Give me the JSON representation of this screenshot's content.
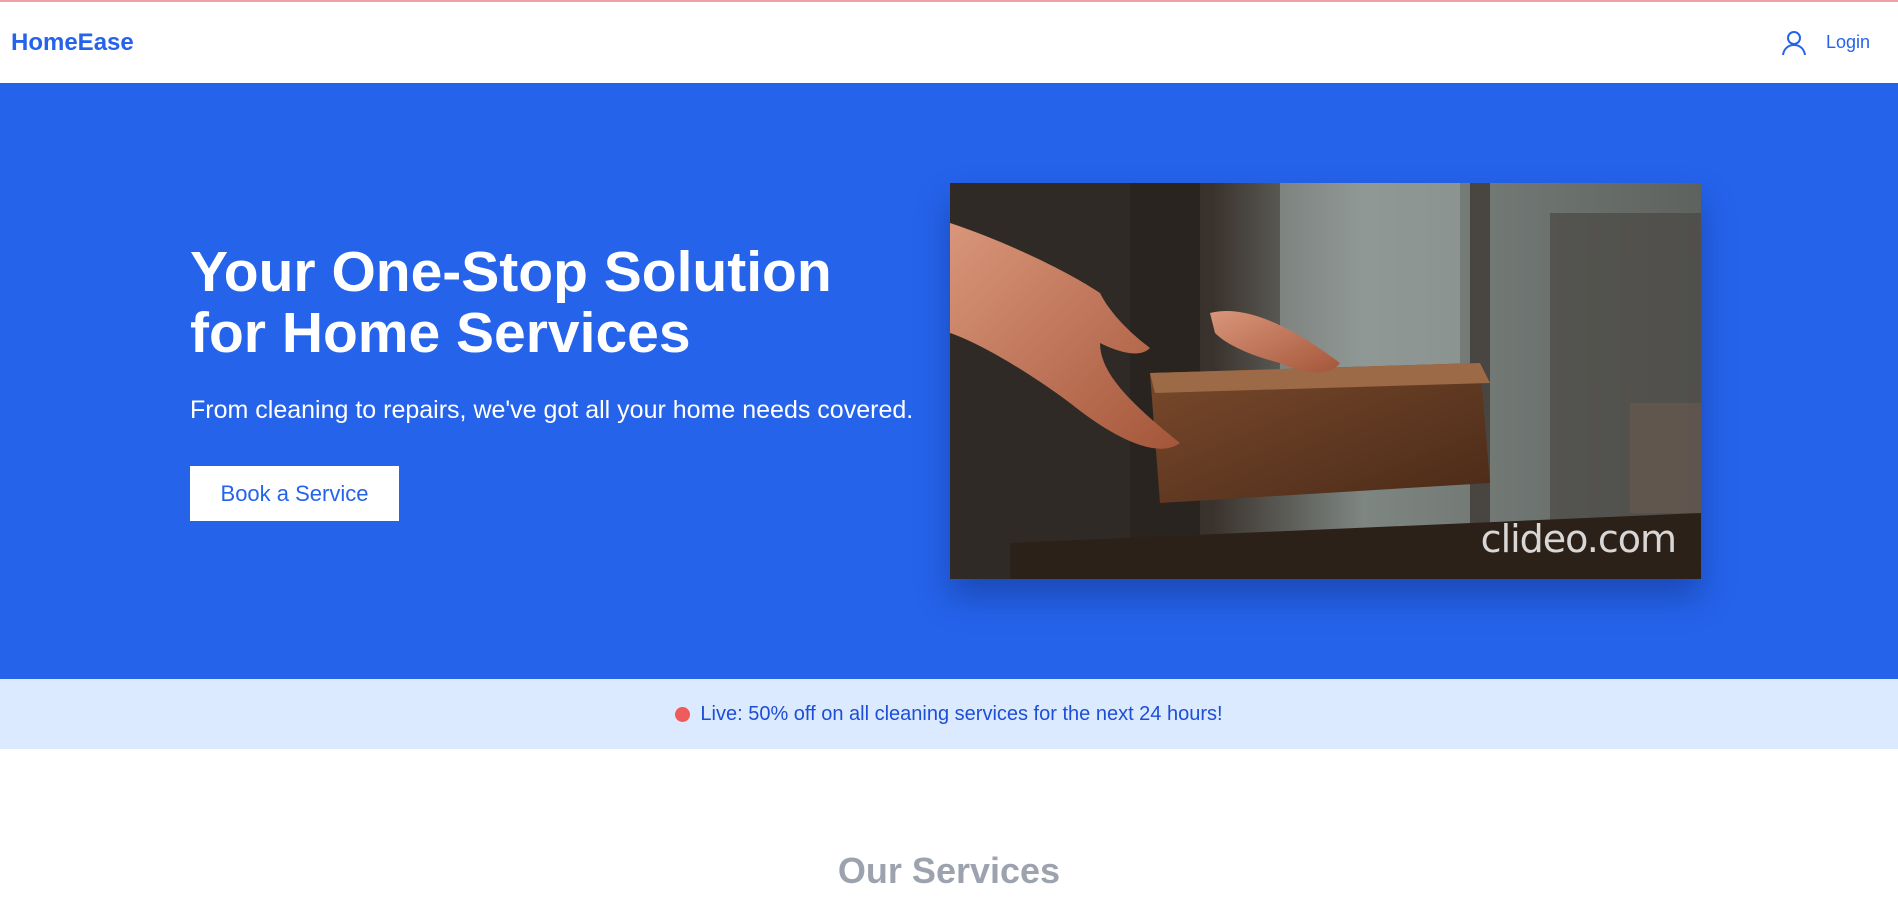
{
  "nav": {
    "brand": "HomeEase",
    "login_label": "Login",
    "user_icon": "user-icon"
  },
  "hero": {
    "title_line1": "Your One-Stop Solution",
    "title_line2": "for Home Services",
    "subtitle": "From cleaning to repairs, we've got all your home needs covered.",
    "cta_label": "Book a Service",
    "media_watermark": "clideo.com"
  },
  "promo": {
    "text": "Live: 50% off on all cleaning services for the next 24 hours!"
  },
  "services": {
    "title": "Our Services"
  },
  "colors": {
    "primary": "#2563eb",
    "promo_bg": "#dbeafe",
    "live_dot": "#ef5a5a",
    "muted_heading": "#9ca3af"
  }
}
